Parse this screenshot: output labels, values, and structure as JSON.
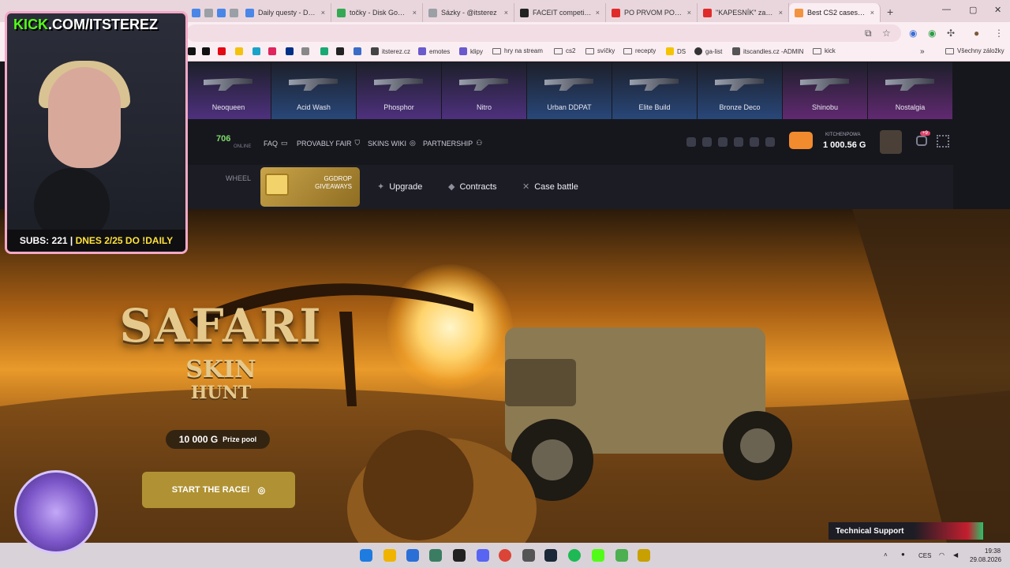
{
  "browser": {
    "tabs": [
      {
        "title": "Daily questy - Doku",
        "color": "#4a86e8"
      },
      {
        "title": "točky - Disk Google",
        "color": "#34a853"
      },
      {
        "title": "Sázky - @itsterez",
        "color": "#9aa0a6"
      },
      {
        "title": "FACEIT competitive",
        "color": "#222222"
      },
      {
        "title": "PO PRVOM POHĽAD",
        "color": "#e02b2b"
      },
      {
        "title": "\"KAPESNÍK\" zase ni",
        "color": "#e02b2b"
      },
      {
        "title": "Best CS2 cases - top",
        "color": "#f29340"
      }
    ],
    "tab_close": "×",
    "new_tab": "+",
    "bookmarks": [
      {
        "label": "itsterez.cz",
        "color": "#444"
      },
      {
        "label": "emotes",
        "color": "#6a5acd"
      },
      {
        "label": "klipy",
        "color": "#6a5acd"
      },
      {
        "label": "hry na stream",
        "folder": true
      },
      {
        "label": "cs2",
        "folder": true
      },
      {
        "label": "svíčky",
        "folder": true
      },
      {
        "label": "recepty",
        "folder": true
      },
      {
        "label": "DS",
        "color": "#f5c400"
      },
      {
        "label": "ga-list",
        "color": "#333"
      },
      {
        "label": "itscandles.cz -ADMIN",
        "color": "#555"
      },
      {
        "label": "kick",
        "folder": true
      }
    ],
    "all_bookmarks": "Všechny záložky",
    "chevron": "»"
  },
  "site": {
    "live_drops": [
      {
        "name": "Neoqueen",
        "color": "#6b3bb0"
      },
      {
        "name": "Acid Wash",
        "color": "#2f5fa8"
      },
      {
        "name": "Phosphor",
        "color": "#6b3bb0"
      },
      {
        "name": "Nitro",
        "color": "#6b3bb0"
      },
      {
        "name": "Urban DDPAT",
        "color": "#2f5fa8"
      },
      {
        "name": "Elite Build",
        "color": "#2f5fa8"
      },
      {
        "name": "Bronze Deco",
        "color": "#2f5fa8"
      },
      {
        "name": "Shinobu",
        "color": "#8a2f9c"
      },
      {
        "name": "Nostalgia",
        "color": "#8a2f9c"
      }
    ],
    "online_count": "706",
    "online_label": "ONLINE",
    "links": {
      "faq": "FAQ",
      "provably_fair": "PROVABLY FAIR",
      "skins_wiki": "SKINS WIKI",
      "partnership": "PARTNERSHIP"
    },
    "user": {
      "name": "KITCHENPOWA",
      "balance": "1 000.56 G",
      "notif_count": "+9"
    },
    "nav": {
      "wheel": "WHEEL",
      "giveaway": "GGDROP GIVEAWAYS",
      "upgrade": "Upgrade",
      "contracts": "Contracts",
      "case_battle": "Case battle"
    },
    "hero": {
      "title": "SAFARI",
      "subtitle1": "SKIN",
      "subtitle2": "HUNT",
      "prize_amount": "10 000 G",
      "prize_label": "Prize pool",
      "cta": "START THE RACE!"
    },
    "support": "Technical Support"
  },
  "taskbar": {
    "icons": [
      "#1e7be0",
      "#f0b400",
      "#2a6fd6",
      "#3a7d62",
      "#222",
      "#5865f2",
      "#db4437",
      "#555",
      "#1b2838",
      "#1db954",
      "#53fc18",
      "#4caf50",
      "#c8a000"
    ],
    "lang": "CES",
    "time": "19:38",
    "date": "29.08.2026"
  },
  "stream": {
    "brand_kick": "KICK",
    "brand_rest": ".COM/ITSTEREZ",
    "subs": "SUBS: 221 | ",
    "daily": "DNES 2/25 DO !DAILY"
  }
}
